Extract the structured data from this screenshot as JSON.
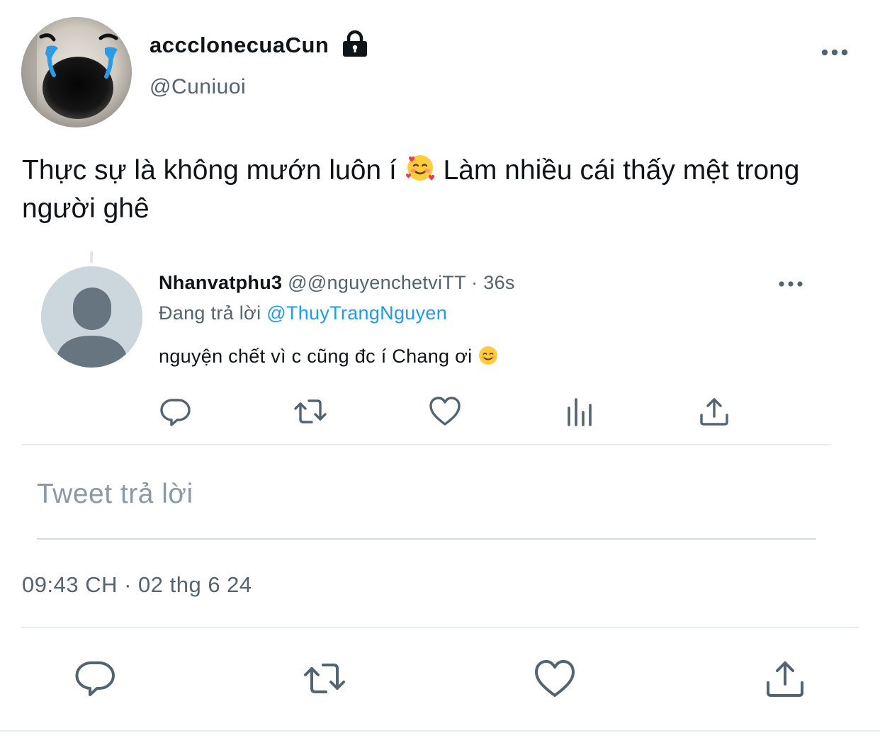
{
  "header": {
    "display_name": "accclonecuaCun",
    "handle": "@Cuniuoi",
    "avatar_icon": "crying-dog-avatar",
    "lock_icon": "lock-icon",
    "more_icon": "more-icon"
  },
  "tweet": {
    "text_part1": "Thực sự là không mướn luôn í",
    "emoji1": "smiling-face-with-hearts",
    "text_part2": " Làm nhiều cái thấy mệt trong người ghê"
  },
  "reply_card": {
    "name": "Nhanvatphu3",
    "handle": "@@nguyenchetviTT",
    "separator": " · ",
    "time": "36s",
    "replying_label": "Đang trả lời",
    "replying_to": "@ThuyTrangNguyen",
    "text": "nguyện chết vì c cũng đc í Chang ơi",
    "emoji": "smiling-face-emoji",
    "actions": [
      "reply-icon",
      "retweet-icon",
      "like-icon",
      "views-icon",
      "share-icon"
    ]
  },
  "compose": {
    "placeholder": "Tweet trả lời"
  },
  "meta": {
    "timestamp": "09:43 CH · 02 thg 6 24"
  },
  "main_actions": [
    "reply-icon",
    "retweet-icon",
    "like-icon",
    "share-icon"
  ],
  "colors": {
    "text": "#0f1419",
    "secondary": "#536471",
    "link": "#1d9bf0",
    "icon": "#536471",
    "placeholder": "#8b98a5"
  }
}
